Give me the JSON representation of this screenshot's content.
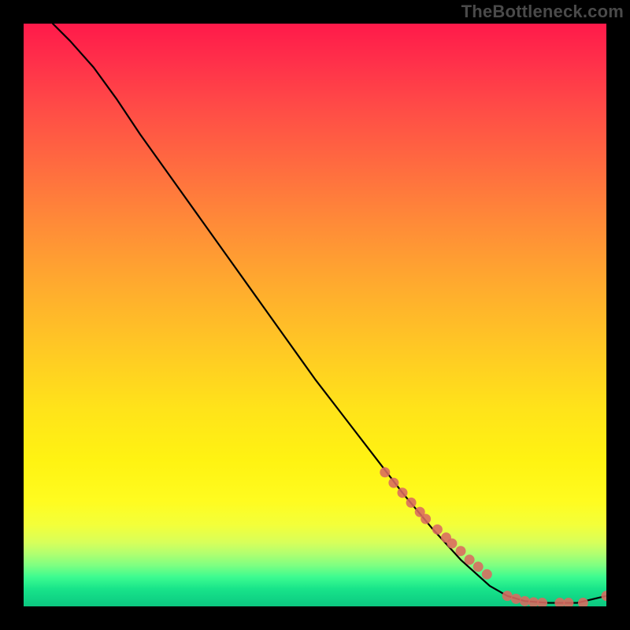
{
  "watermark": "TheBottleneck.com",
  "chart_data": {
    "type": "line",
    "title": "",
    "xlabel": "",
    "ylabel": "",
    "xlim": [
      0,
      100
    ],
    "ylim": [
      0,
      100
    ],
    "grid": false,
    "legend": false,
    "series": [
      {
        "name": "curve",
        "style": "line",
        "color": "#000000",
        "x": [
          5,
          8,
          12,
          16,
          20,
          25,
          30,
          35,
          40,
          45,
          50,
          55,
          60,
          65,
          70,
          75,
          80,
          83,
          86,
          90,
          95,
          100
        ],
        "y": [
          100,
          97,
          92.5,
          87,
          81,
          74,
          67,
          60,
          53,
          46,
          39,
          32.5,
          26,
          19.5,
          13.5,
          8,
          3.5,
          1.8,
          0.9,
          0.6,
          0.6,
          1.8
        ]
      },
      {
        "name": "points",
        "style": "scatter",
        "color": "#d96a60",
        "x": [
          62,
          63.5,
          65,
          66.5,
          68,
          69,
          71,
          72.5,
          73.5,
          75,
          76.5,
          78,
          79.5,
          83,
          84.5,
          86,
          87.5,
          89,
          92,
          93.5,
          96,
          100
        ],
        "y": [
          23,
          21.2,
          19.5,
          17.8,
          16.2,
          15,
          13.2,
          11.8,
          10.8,
          9.5,
          8,
          6.8,
          5.5,
          1.8,
          1.3,
          0.9,
          0.7,
          0.6,
          0.6,
          0.6,
          0.6,
          1.8
        ]
      }
    ],
    "background_gradient": {
      "direction": "vertical",
      "stops": [
        {
          "pos": 0.0,
          "color": "#ff1a4a"
        },
        {
          "pos": 0.4,
          "color": "#ffab2e"
        },
        {
          "pos": 0.75,
          "color": "#fff312"
        },
        {
          "pos": 0.93,
          "color": "#7dff82"
        },
        {
          "pos": 1.0,
          "color": "#0cc780"
        }
      ]
    }
  }
}
